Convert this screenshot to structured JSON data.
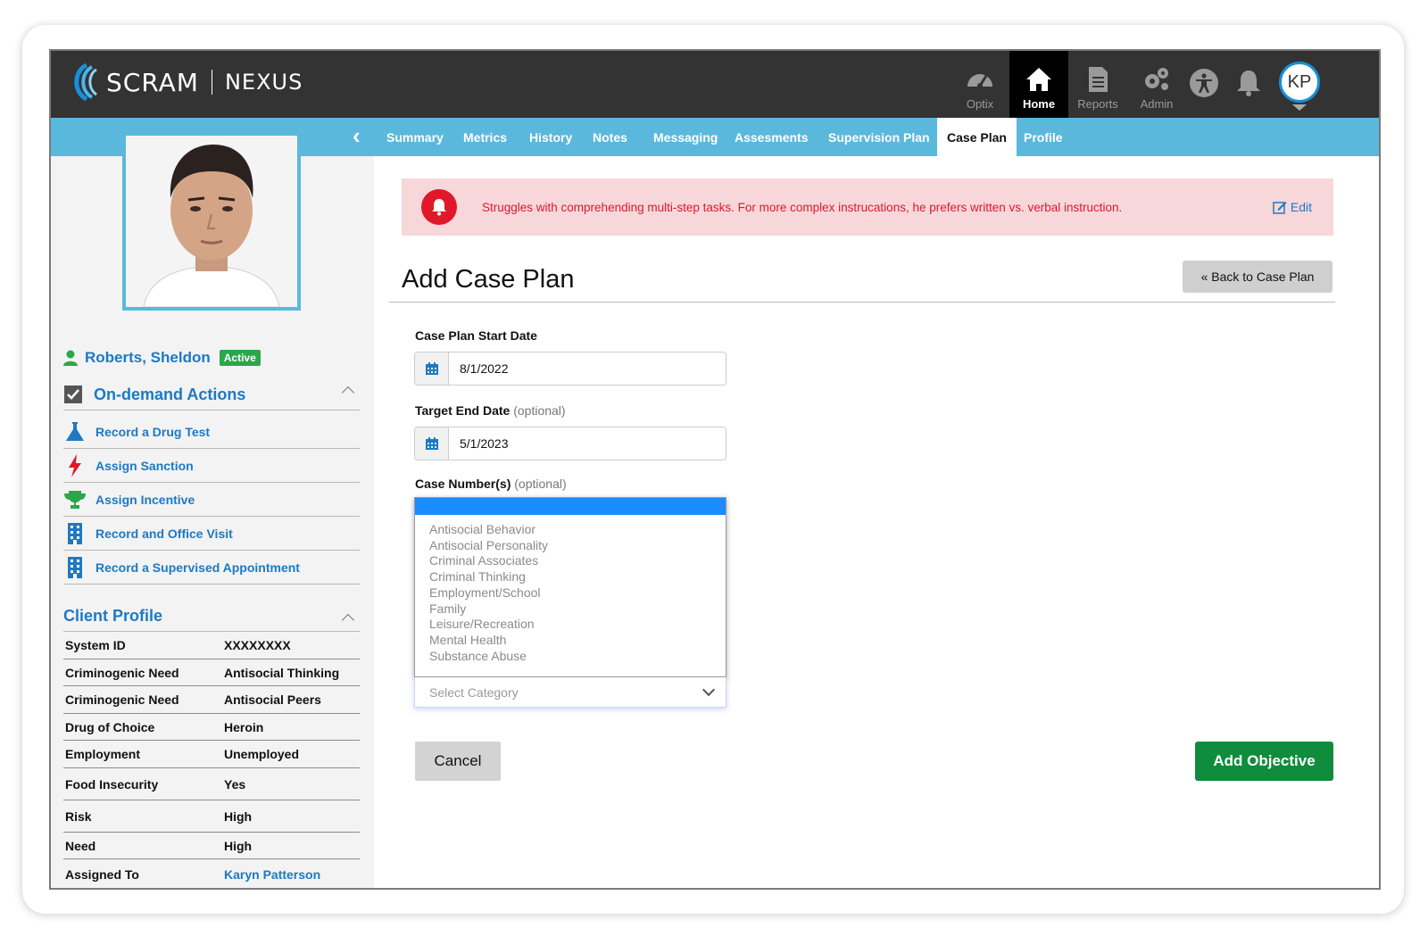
{
  "header": {
    "brand": "SCRAM",
    "product": "NEXUS",
    "nav": [
      {
        "label": "Optix",
        "icon": "gauge-icon"
      },
      {
        "label": "Home",
        "icon": "home-icon"
      },
      {
        "label": "Reports",
        "icon": "document-icon"
      },
      {
        "label": "Admin",
        "icon": "gears-icon"
      }
    ],
    "active_nav": "Home",
    "accessibility_icon": "accessibility-icon",
    "notifications_icon": "bell-icon",
    "user_initials": "KP"
  },
  "subnav": {
    "tabs": [
      "Summary",
      "Metrics",
      "History",
      "Notes",
      "Messaging",
      "Assesments",
      "Supervision Plan",
      "Case Plan",
      "Profile"
    ],
    "active_tab": "Case Plan"
  },
  "sidebar": {
    "client_name": "Roberts, Sheldon",
    "status": "Active",
    "actions_title": "On-demand Actions",
    "actions": [
      {
        "label": "Record a Drug Test",
        "icon": "flask-icon"
      },
      {
        "label": "Assign Sanction",
        "icon": "lightning-icon"
      },
      {
        "label": "Assign Incentive",
        "icon": "trophy-icon"
      },
      {
        "label": "Record and Office Visit",
        "icon": "building-icon"
      },
      {
        "label": "Record a Supervised Appointment",
        "icon": "building-icon"
      }
    ],
    "profile_title": "Client Profile",
    "profile": [
      {
        "key": "System ID",
        "value": "XXXXXXXX"
      },
      {
        "key": "Criminogenic Need",
        "value": "Antisocial Thinking"
      },
      {
        "key": "Criminogenic Need",
        "value": "Antisocial Peers"
      },
      {
        "key": "Drug of Choice",
        "value": "Heroin"
      },
      {
        "key": "Employment",
        "value": "Unemployed"
      },
      {
        "key": "Food Insecurity",
        "value": "Yes"
      },
      {
        "key": "Risk",
        "value": "High"
      },
      {
        "key": "Need",
        "value": "High"
      },
      {
        "key": "Assigned To",
        "value": "Karyn Patterson"
      }
    ]
  },
  "alert": {
    "text": "Struggles with comprehending multi-step tasks. For more complex instrucations, he prefers written vs. verbal instruction.",
    "edit_label": "Edit"
  },
  "main": {
    "title": "Add Case Plan",
    "back_button": "« Back to Case Plan",
    "start_date_label": "Case Plan Start Date",
    "start_date": "8/1/2022",
    "end_date_label": "Target End Date",
    "end_date_optional": "(optional)",
    "end_date": "5/1/2023",
    "case_number_label": "Case Number(s)",
    "case_number_optional": "(optional)",
    "category_options": [
      "Antisocial Behavior",
      "Antisocial Personality",
      "Criminal Associates",
      "Criminal Thinking",
      "Employment/School",
      "Family",
      "Leisure/Recreation",
      "Mental Health",
      "Substance Abuse"
    ],
    "category_placeholder": "Select Category",
    "cancel_button": "Cancel",
    "add_button": "Add Objective"
  },
  "colors": {
    "header_bg": "#333333",
    "subnav_bg": "#5bb8dd",
    "link_blue": "#1d79c4",
    "alert_bg": "#f8d7da",
    "alert_red": "#e0192a",
    "active_green": "#2aa74b",
    "primary_green": "#0f8c3c"
  }
}
